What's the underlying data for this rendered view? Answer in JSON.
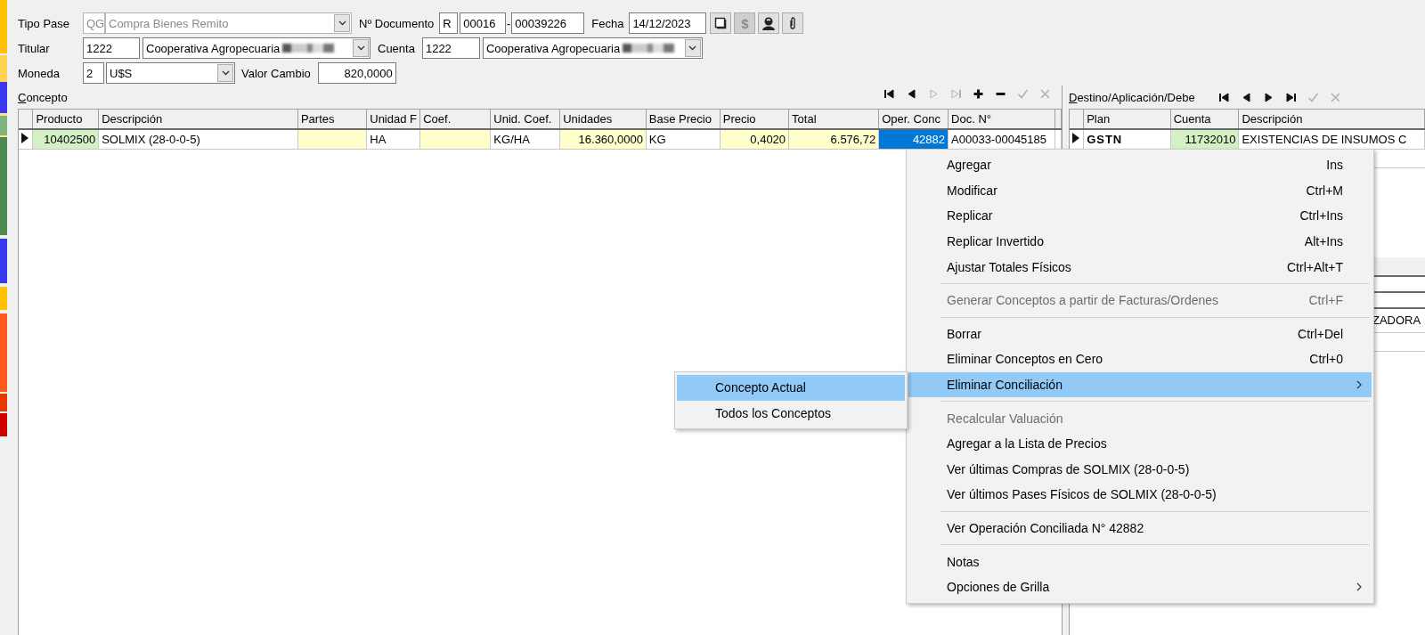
{
  "header": {
    "tipo_pase": {
      "label": "Tipo Pase",
      "code": "QG",
      "value": "Compra Bienes Remito",
      "disabled": true
    },
    "documento": {
      "label": "Nº Documento",
      "letter": "R",
      "prefix": "00016",
      "separator": "-",
      "number": "00039226"
    },
    "fecha": {
      "label": "Fecha",
      "value": "14/12/2023"
    },
    "toolbar": [
      {
        "kind": "page",
        "disabled": false
      },
      {
        "kind": "dollar",
        "label": "$",
        "disabled": true
      },
      {
        "kind": "person",
        "disabled": false
      },
      {
        "kind": "clip",
        "disabled": false
      }
    ],
    "titular": {
      "label": "Titular",
      "code": "1222",
      "name": "Cooperativa Agropecuaria"
    },
    "cuenta": {
      "label": "Cuenta",
      "code": "1222",
      "name": "Cooperativa Agropecuaria"
    },
    "moneda": {
      "label": "Moneda",
      "code": "2",
      "value": "U$S"
    },
    "valor_cambio": {
      "label": "Valor Cambio",
      "value": "820,0000"
    }
  },
  "concepto": {
    "title": "Concepto",
    "nav": [
      {
        "kind": "first",
        "disabled": false
      },
      {
        "kind": "prev",
        "disabled": false
      },
      {
        "kind": "next",
        "disabled": true
      },
      {
        "kind": "last",
        "disabled": true
      },
      {
        "kind": "add",
        "disabled": false
      },
      {
        "kind": "remove",
        "disabled": false
      },
      {
        "kind": "confirm",
        "disabled": true
      },
      {
        "kind": "cancel",
        "disabled": true
      }
    ],
    "columns": [
      {
        "label": "Producto",
        "numeric": true
      },
      {
        "label": "Descripción",
        "numeric": false
      },
      {
        "label": "Partes"
      },
      {
        "label": "Unidad F",
        "numeric": false
      },
      {
        "label": "Coef."
      },
      {
        "label": "Unid. Coef.",
        "numeric": false
      },
      {
        "label": "Unidades",
        "numeric": true
      },
      {
        "label": "Base Precio",
        "numeric": false
      },
      {
        "label": "Precio",
        "numeric": true
      },
      {
        "label": "Total",
        "numeric": true
      },
      {
        "label": "Oper. Conc",
        "numeric": true
      },
      {
        "label": "Doc. N°",
        "numeric": false
      }
    ],
    "rows": [
      {
        "current": true,
        "cells": [
          {
            "text": "10402500",
            "kind": "lookup",
            "selected": false
          },
          {
            "text": "SOLMIX (28-0-0-5)",
            "kind": "text",
            "selected": false
          },
          {
            "text": "",
            "kind": "editable",
            "selected": false
          },
          {
            "text": "HA",
            "kind": "text",
            "selected": false
          },
          {
            "text": "",
            "kind": "editable",
            "selected": false
          },
          {
            "text": "KG/HA",
            "kind": "text",
            "selected": false
          },
          {
            "text": "16.360,0000",
            "kind": "editable",
            "selected": false
          },
          {
            "text": "KG",
            "kind": "text",
            "selected": false
          },
          {
            "text": "0,4020",
            "kind": "editable",
            "selected": false
          },
          {
            "text": "6.576,72",
            "kind": "editable",
            "selected": false
          },
          {
            "text": "42882",
            "kind": "text",
            "selected": true
          },
          {
            "text": "A00033-00045185",
            "kind": "text",
            "selected": false
          }
        ]
      }
    ]
  },
  "destino": {
    "title": "Destino/Aplicación/Debe",
    "nav": [
      {
        "kind": "first",
        "disabled": false
      },
      {
        "kind": "prev",
        "disabled": false
      },
      {
        "kind": "next",
        "disabled": false
      },
      {
        "kind": "last",
        "disabled": false
      },
      {
        "kind": "confirm",
        "disabled": true
      },
      {
        "kind": "cancel",
        "disabled": true
      }
    ],
    "columns": [
      {
        "label": "Plan",
        "numeric": false
      },
      {
        "label": "Cuenta",
        "numeric": true
      },
      {
        "label": "Descripción",
        "numeric": false
      }
    ],
    "rows": [
      {
        "current": true,
        "cells": [
          {
            "text": "GSTN",
            "kind": "bold",
            "selected": false
          },
          {
            "text": "11732010",
            "kind": "lookup",
            "selected": false
          },
          {
            "text": "EXISTENCIAS DE INSUMOS C",
            "kind": "text",
            "selected": false
          }
        ]
      }
    ],
    "hidden_row_text": "ZADORA"
  },
  "context_menu": {
    "items": [
      {
        "kind": "item",
        "label": "Agregar",
        "shortcut": "Ins",
        "disabled": false,
        "selected": false,
        "submenu": false
      },
      {
        "kind": "item",
        "label": "Modificar",
        "shortcut": "Ctrl+M",
        "disabled": false,
        "selected": false,
        "submenu": false
      },
      {
        "kind": "item",
        "label": "Replicar",
        "shortcut": "Ctrl+Ins",
        "disabled": false,
        "selected": false,
        "submenu": false
      },
      {
        "kind": "item",
        "label": "Replicar Invertido",
        "shortcut": "Alt+Ins",
        "disabled": false,
        "selected": false,
        "submenu": false
      },
      {
        "kind": "item",
        "label": "Ajustar Totales Físicos",
        "shortcut": "Ctrl+Alt+T",
        "disabled": false,
        "selected": false,
        "submenu": false
      },
      {
        "kind": "separator"
      },
      {
        "kind": "item",
        "label": "Generar Conceptos a partir de Facturas/Ordenes",
        "shortcut": "Ctrl+F",
        "disabled": true,
        "selected": false,
        "submenu": false
      },
      {
        "kind": "separator"
      },
      {
        "kind": "item",
        "label": "Borrar",
        "shortcut": "Ctrl+Del",
        "disabled": false,
        "selected": false,
        "submenu": false
      },
      {
        "kind": "item",
        "label": "Eliminar Conceptos en Cero",
        "shortcut": "Ctrl+0",
        "disabled": false,
        "selected": false,
        "submenu": false
      },
      {
        "kind": "item",
        "label": "Eliminar Conciliación",
        "disabled": false,
        "selected": true,
        "submenu": true
      },
      {
        "kind": "separator"
      },
      {
        "kind": "item",
        "label": "Recalcular Valuación",
        "disabled": true,
        "selected": false,
        "submenu": false
      },
      {
        "kind": "item",
        "label": "Agregar a la Lista de Precios",
        "disabled": false,
        "selected": false,
        "submenu": false
      },
      {
        "kind": "item",
        "label": "Ver últimas Compras de SOLMIX (28-0-0-5)",
        "disabled": false,
        "selected": false,
        "submenu": false
      },
      {
        "kind": "item",
        "label": "Ver últimos Pases Físicos de SOLMIX (28-0-0-5)",
        "disabled": false,
        "selected": false,
        "submenu": false
      },
      {
        "kind": "separator"
      },
      {
        "kind": "item",
        "label": "Ver Operación Conciliada N° 42882",
        "disabled": false,
        "selected": false,
        "submenu": false
      },
      {
        "kind": "separator"
      },
      {
        "kind": "item",
        "label": "Notas",
        "disabled": false,
        "selected": false,
        "submenu": false
      },
      {
        "kind": "item",
        "label": "Opciones de Grilla",
        "disabled": false,
        "selected": false,
        "submenu": true
      }
    ],
    "submenu": {
      "items": [
        {
          "kind": "item",
          "label": "Concepto Actual",
          "disabled": false,
          "selected": true,
          "submenu": false
        },
        {
          "kind": "item",
          "label": "Todos los Conceptos",
          "disabled": false,
          "selected": false,
          "submenu": false
        }
      ]
    }
  }
}
